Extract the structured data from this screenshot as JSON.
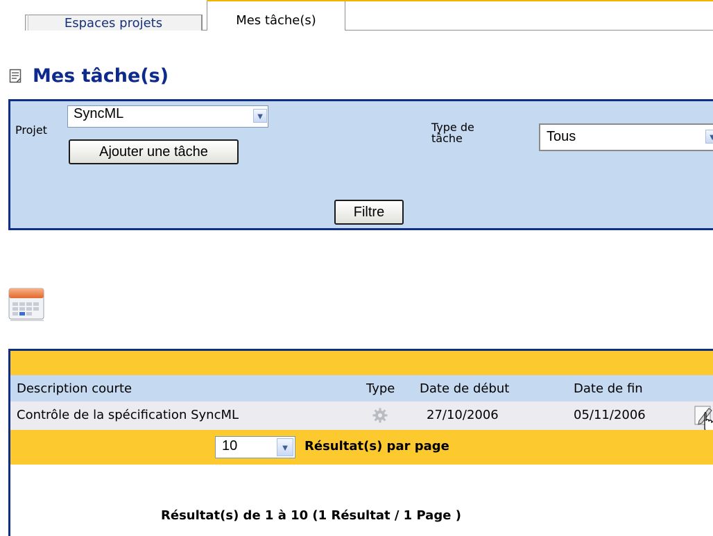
{
  "tabs": [
    {
      "label": "Espaces projets",
      "active": false
    },
    {
      "label": "Mes tâche(s)",
      "active": true
    }
  ],
  "page": {
    "title": "Mes tâche(s)"
  },
  "filter": {
    "project_label": "Projet",
    "project_value": "SyncML",
    "add_task_button": "Ajouter une tâche",
    "task_type_label_line1": "Type de",
    "task_type_label_line2": "tâche",
    "task_type_value": "Tous",
    "filter_button": "Filtre"
  },
  "table": {
    "columns": [
      "Description courte",
      "Type",
      "Date de début",
      "Date de fin"
    ],
    "rows": [
      {
        "description": "Contrôle de la spécification SyncML",
        "type_icon": "gear-icon",
        "start": "27/10/2006",
        "end": "05/11/2006",
        "action_icon": "edit-icon"
      }
    ],
    "page_size": "10",
    "per_page_label": "Résultat(s) par page",
    "summary": "Résultat(s) de 1 à 10 (1 Résultat / 1 Page )"
  },
  "colors": {
    "accent_yellow": "#fcc92e",
    "panel_blue": "#c5d9f0",
    "border_navy": "#0f2e86",
    "title_blue": "#0d2a8c"
  }
}
